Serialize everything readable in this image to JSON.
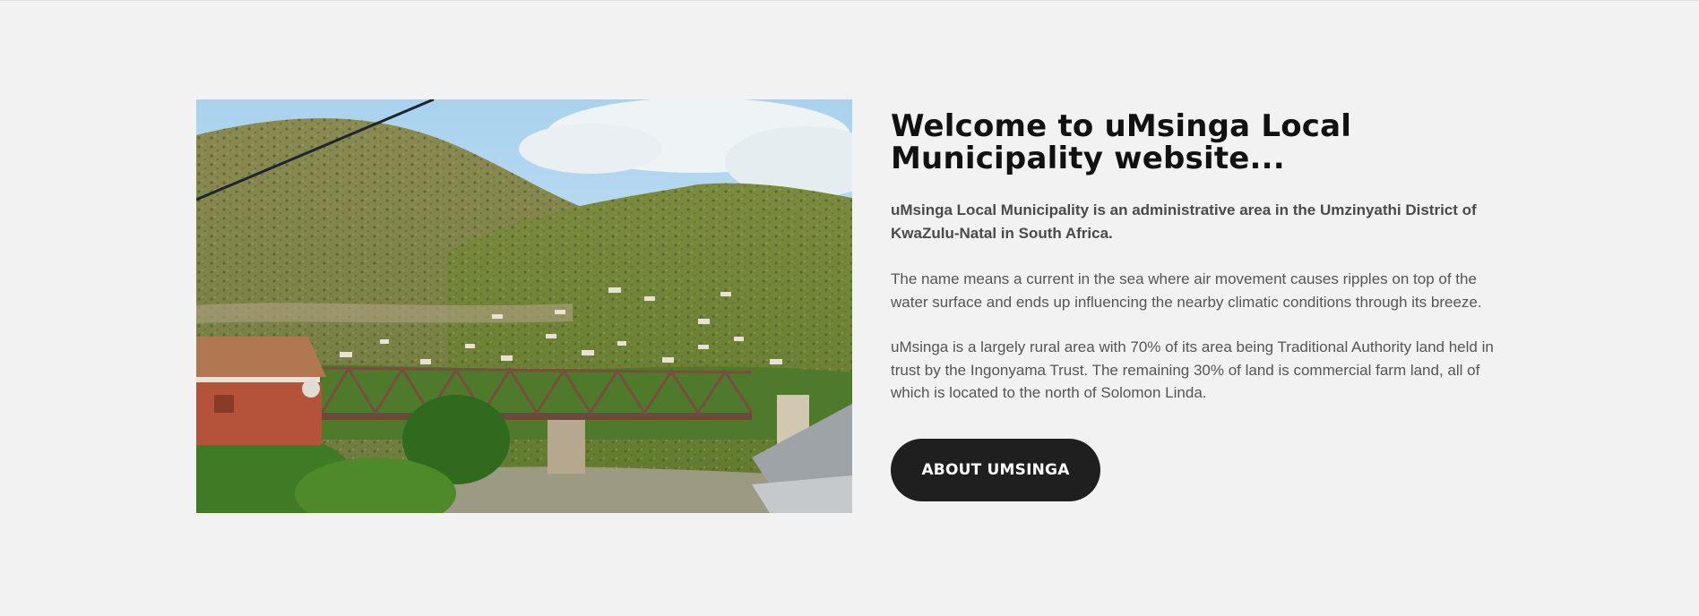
{
  "hero": {
    "image_alt": "Hills and bridge over river in uMsinga",
    "title": "Welcome to uMsinga Local Municipality website...",
    "lead": "uMsinga Local Municipality is an administrative area in the Umzinyathi District of KwaZulu-Natal in South Africa.",
    "paragraphs": [
      "The name means a current in the sea where air movement causes ripples on top of the water surface and ends up influencing the nearby climatic conditions through its breeze.",
      "uMsinga is a largely rural area with 70% of its area being Traditional Authority land held in trust by the Ingonyama Trust. The remaining 30% of land is commercial farm land, all of which is located to the north of Solomon Linda."
    ],
    "button_label": "ABOUT UMSINGA"
  },
  "colors": {
    "background": "#f2f2f2",
    "title": "#111111",
    "body_text": "#555555",
    "button_bg": "#1f1f1f",
    "button_text": "#ffffff"
  }
}
